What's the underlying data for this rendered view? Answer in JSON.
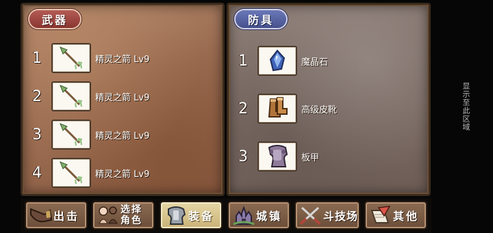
{
  "weapon_panel": {
    "title": "武器",
    "items": [
      {
        "index": "1",
        "name": "精灵之箭 Lv9",
        "icon": "arrow-icon"
      },
      {
        "index": "2",
        "name": "精灵之箭 Lv9",
        "icon": "arrow-icon"
      },
      {
        "index": "3",
        "name": "精灵之箭 Lv9",
        "icon": "arrow-icon"
      },
      {
        "index": "4",
        "name": "精灵之箭 Lv9",
        "icon": "arrow-icon"
      }
    ]
  },
  "armor_panel": {
    "title": "防具",
    "items": [
      {
        "index": "1",
        "name": "魔晶石",
        "icon": "crystal-icon"
      },
      {
        "index": "2",
        "name": "高级皮靴",
        "icon": "boots-icon"
      },
      {
        "index": "3",
        "name": "板甲",
        "icon": "plate-armor-icon"
      }
    ]
  },
  "nav": {
    "sortie": "出击",
    "select_role_line1": "选择",
    "select_role_line2": "角色",
    "equipment": "装备",
    "town": "城镇",
    "arena": "斗技场",
    "other": "其他",
    "active": "equipment"
  },
  "side_hint": "显示至此区域"
}
